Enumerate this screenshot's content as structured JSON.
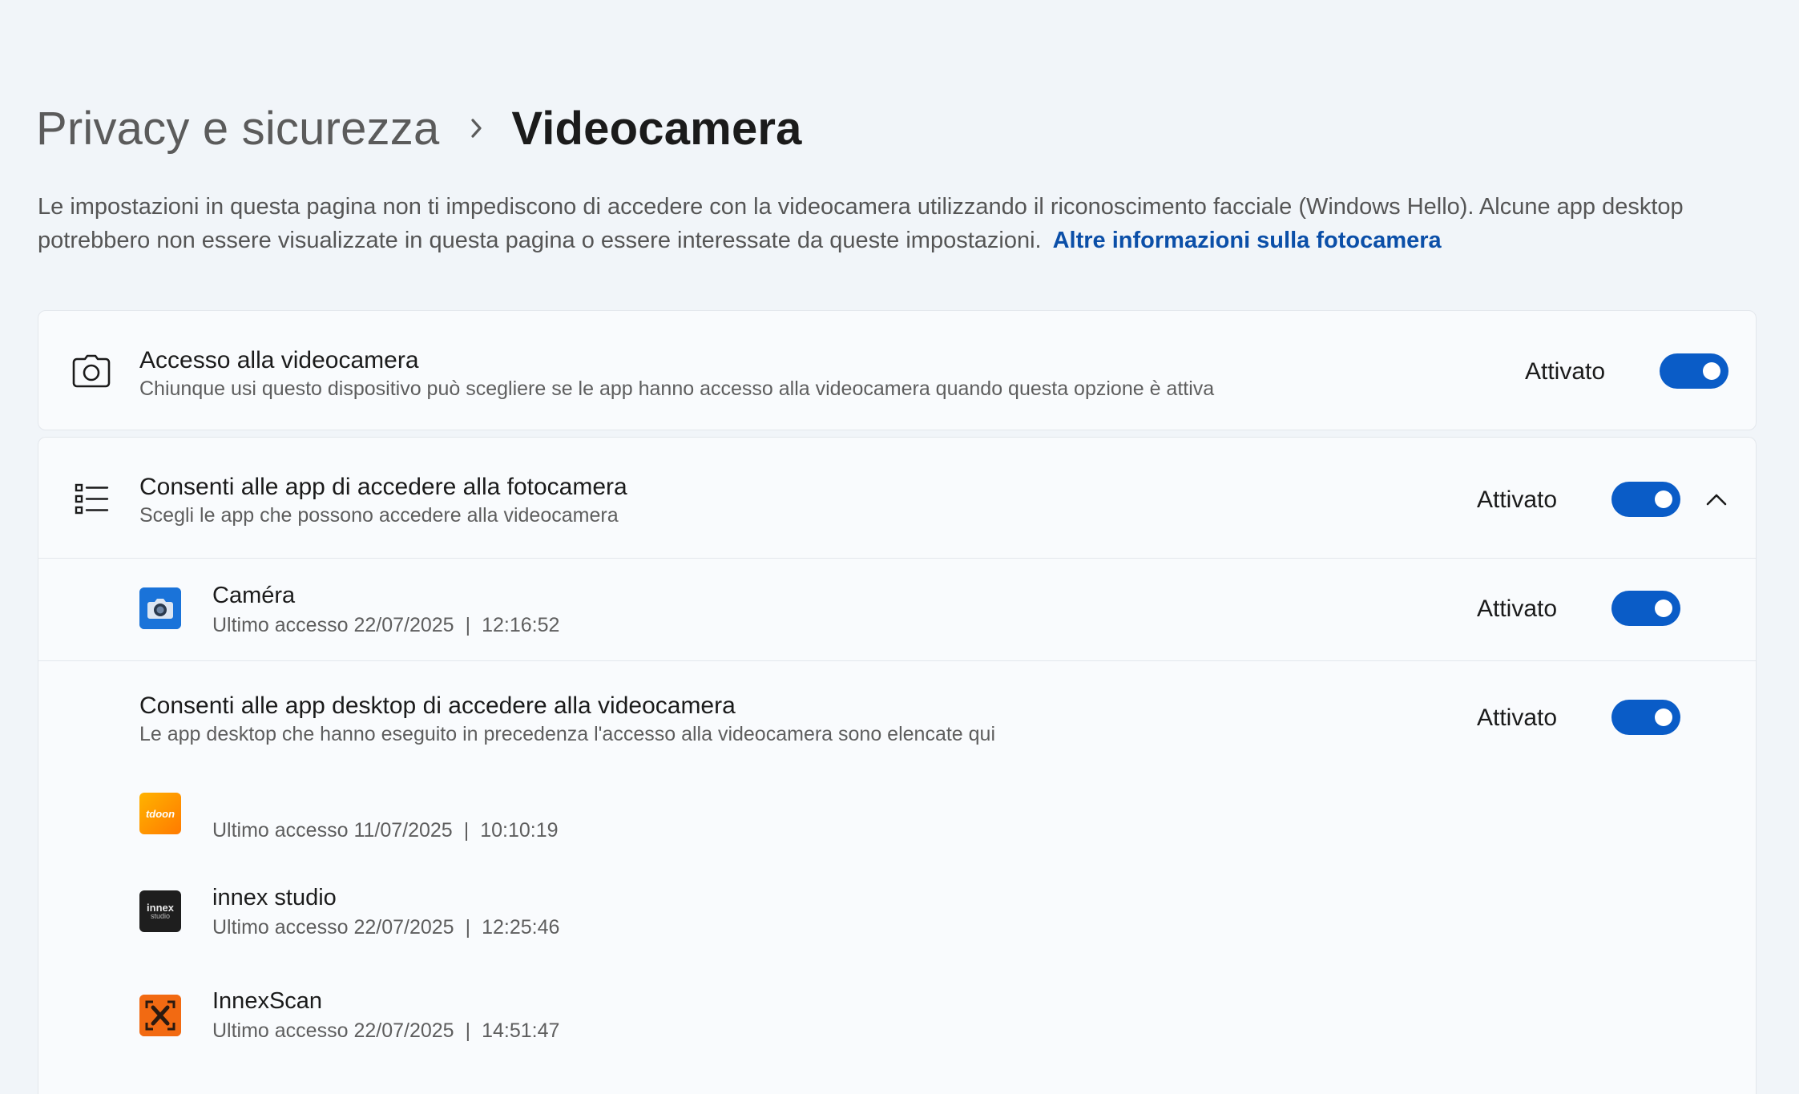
{
  "breadcrumb": {
    "parent": "Privacy e sicurezza",
    "current": "Videocamera"
  },
  "description": {
    "text": "Le impostazioni in questa pagina non ti impediscono di accedere con la videocamera utilizzando il riconoscimento facciale (Windows Hello). Alcune app desktop potrebbero non essere visualizzate in questa pagina o essere interessate da queste impostazioni.",
    "link": "Altre informazioni sulla fotocamera"
  },
  "camera_access": {
    "icon": "camera-icon",
    "title": "Accesso alla videocamera",
    "subtitle": "Chiunque usi questo dispositivo può scegliere se le app hanno accesso alla videocamera quando questa opzione è attiva",
    "state": "Attivato",
    "on": true
  },
  "app_access": {
    "icon": "list-icon",
    "title": "Consenti alle app di accedere alla fotocamera",
    "subtitle": "Scegli le app che possono accedere alla videocamera",
    "state": "Attivato",
    "on": true,
    "expanded": true,
    "apps": [
      {
        "name": "Caméra",
        "last_access_label": "Ultimo accesso 22/07/2025",
        "time": "12:16:52",
        "state": "Attivato",
        "on": true
      }
    ]
  },
  "desktop_access": {
    "title": "Consenti alle app desktop di accedere alla videocamera",
    "subtitle": "Le app desktop che hanno eseguito in precedenza l'accesso alla videocamera sono elencate qui",
    "state": "Attivato",
    "on": true,
    "apps": [
      {
        "name": "",
        "icon_text": "tdoon",
        "last_access_label": "Ultimo accesso 11/07/2025",
        "time": "10:10:19"
      },
      {
        "name": "innex studio",
        "icon_text_top": "innex",
        "icon_text_bottom": "studio",
        "last_access_label": "Ultimo accesso 22/07/2025",
        "time": "12:25:46"
      },
      {
        "name": "InnexScan",
        "last_access_label": "Ultimo accesso 22/07/2025",
        "time": "14:51:47"
      }
    ]
  },
  "separator": "|",
  "colors": {
    "accent": "#0a5cc7",
    "link": "#0b4fa8",
    "background": "#f1f5f9",
    "card": "#f9fbfd"
  }
}
